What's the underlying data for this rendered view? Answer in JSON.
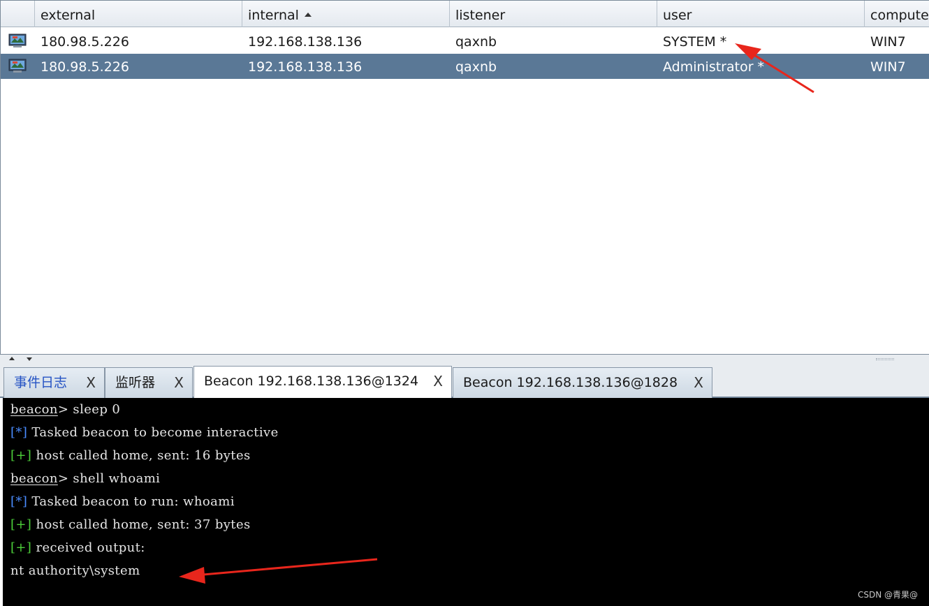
{
  "table": {
    "columns": [
      {
        "label": ""
      },
      {
        "label": "external"
      },
      {
        "label": "internal",
        "sorted": "ascending"
      },
      {
        "label": "listener"
      },
      {
        "label": "user"
      },
      {
        "label": "computer"
      }
    ],
    "rows": [
      {
        "icon": "monitor-icon",
        "external": "180.98.5.226",
        "internal": "192.168.138.136",
        "listener": "qaxnb",
        "user": "SYSTEM *",
        "computer": "WIN7",
        "selected": false
      },
      {
        "icon": "monitor-icon",
        "external": "180.98.5.226",
        "internal": "192.168.138.136",
        "listener": "qaxnb",
        "user": "Administrator *",
        "computer": "WIN7",
        "selected": true
      }
    ]
  },
  "tabs": [
    {
      "label": "事件日志",
      "close": "X",
      "active": false
    },
    {
      "label": "监听器",
      "close": "X",
      "active": false
    },
    {
      "label": "Beacon 192.168.138.136@1324",
      "close": "X",
      "active": true
    },
    {
      "label": "Beacon 192.168.138.136@1828",
      "close": "X",
      "active": false
    }
  ],
  "console": {
    "lines": [
      {
        "prompt": "beacon",
        "text": "> sleep 0"
      },
      {
        "marker": "[*]",
        "text": " Tasked beacon to become interactive"
      },
      {
        "marker": "[+]",
        "text": " host called home, sent: 16 bytes"
      },
      {
        "prompt": "beacon",
        "text": "> shell whoami"
      },
      {
        "marker": "[*]",
        "text": " Tasked beacon to run: whoami"
      },
      {
        "marker": "[+]",
        "text": " host called home, sent: 37 bytes"
      },
      {
        "marker": "[+]",
        "text": " received output:"
      },
      {
        "text": "nt authority\\system"
      }
    ]
  },
  "watermark": "CSDN @青果@",
  "colors": {
    "selected_row": "#5a7896",
    "console_bg": "#000000",
    "marker_info": "#4a8cff",
    "marker_ok": "#4ccf3a",
    "annotation_arrow": "#e8261c"
  }
}
